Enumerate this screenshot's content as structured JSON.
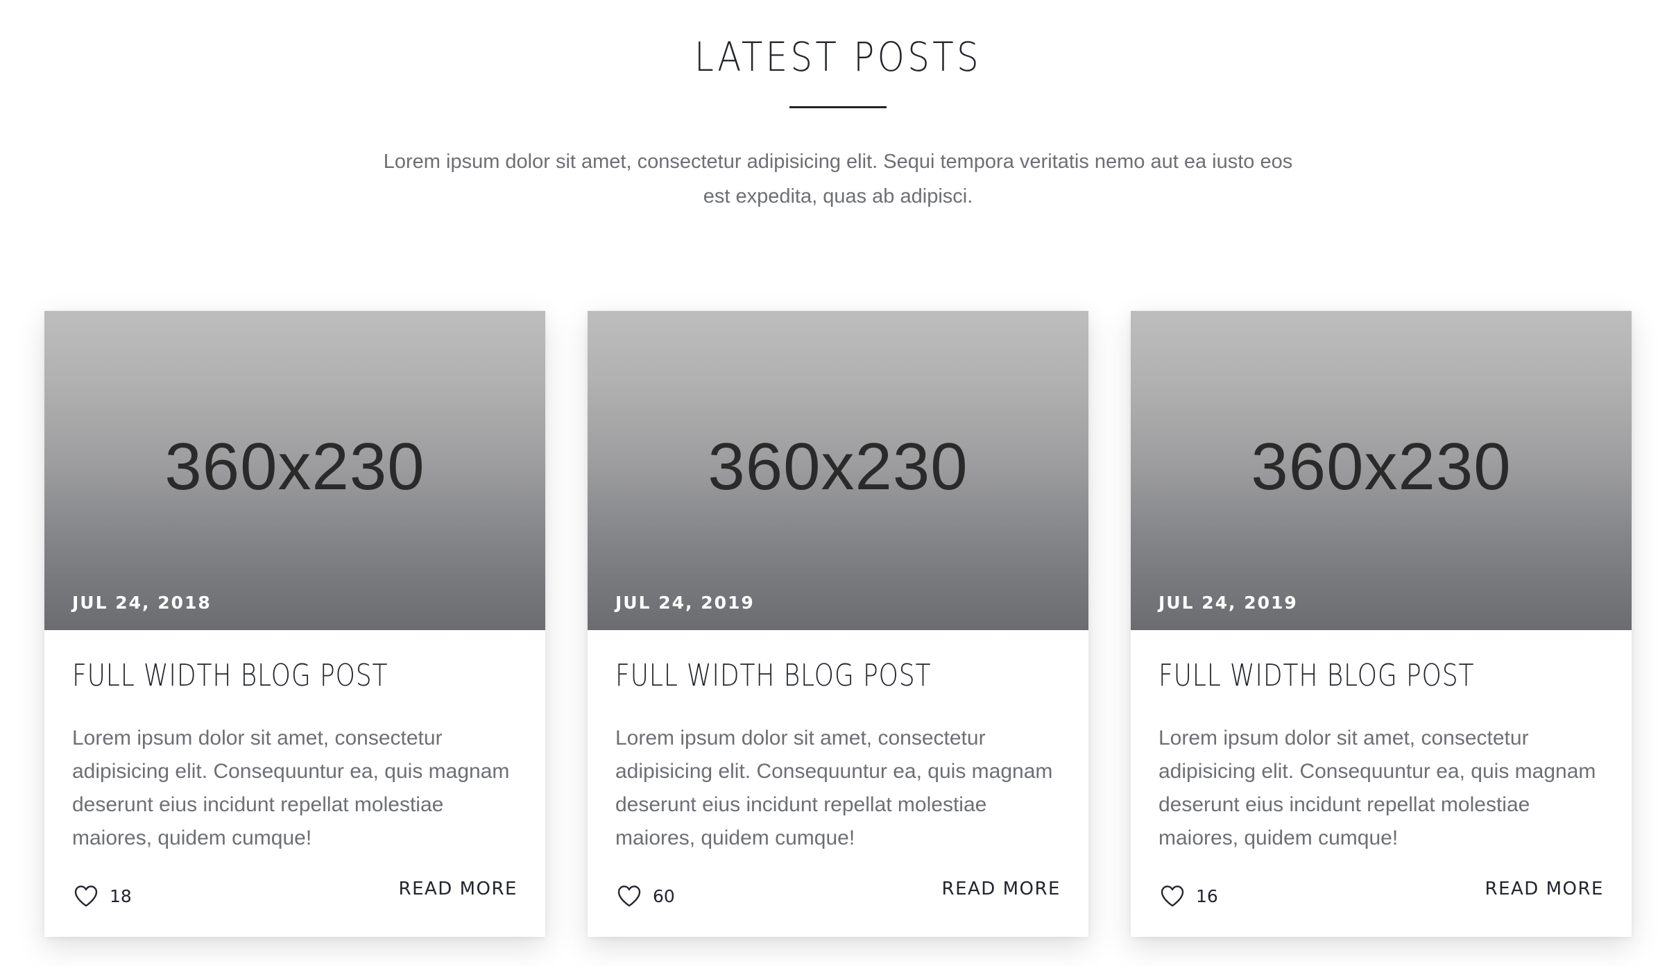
{
  "section": {
    "title": "LATEST POSTS",
    "intro_line1": "Lorem ipsum dolor sit amet, consectetur adipisicing elit. Sequi tempora veritatis nemo aut ea iusto eos",
    "intro_line2": "est expedita, quas ab adipisci."
  },
  "posts": [
    {
      "image_label": "360x230",
      "date": "JUL 24, 2018",
      "title": "FULL WIDTH BLOG POST",
      "excerpt": "Lorem ipsum dolor sit amet, consectetur adipisicing elit. Consequuntur ea, quis magnam deserunt eius incidunt repellat molestiae maiores, quidem cumque!",
      "likes": "18",
      "read_more": "READ MORE",
      "like_icon": "heart-outline"
    },
    {
      "image_label": "360x230",
      "date": "JUL 24, 2019",
      "title": "FULL WIDTH BLOG POST",
      "excerpt": "Lorem ipsum dolor sit amet, consectetur adipisicing elit. Consequuntur ea, quis magnam deserunt eius incidunt repellat molestiae maiores, quidem cumque!",
      "likes": "60",
      "read_more": "READ MORE",
      "like_icon": "heart-outline"
    },
    {
      "image_label": "360x230",
      "date": "JUL 24, 2019",
      "title": "FULL WIDTH BLOG POST",
      "excerpt": "Lorem ipsum dolor sit amet, consectetur adipisicing elit. Consequuntur ea, quis magnam deserunt eius incidunt repellat molestiae maiores, quidem cumque!",
      "likes": "16",
      "read_more": "READ MORE",
      "like_icon": "heart-outline"
    }
  ],
  "colors": {
    "heading": "#22252b",
    "body_text": "#6d6f73",
    "date_text": "#ffffff",
    "background": "#ffffff"
  }
}
